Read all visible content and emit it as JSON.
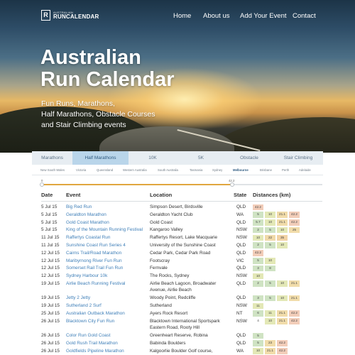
{
  "brand": {
    "small": "AUSTRALIAN",
    "big": "RUNCALENDAR",
    "mark": "R"
  },
  "nav": [
    {
      "label": "Home"
    },
    {
      "label": "About us"
    },
    {
      "label": "Add Your Event"
    },
    {
      "label": "Contact"
    }
  ],
  "hero": {
    "title_line1": "Australian",
    "title_line2": "Run Calendar",
    "sub_line1": "Fun Runs, Marathons,",
    "sub_line2": "Half Marathons, Obstacle Courses",
    "sub_line3": "and Stair Climbing events"
  },
  "categories": [
    {
      "label": "Marathons",
      "active": false
    },
    {
      "label": "Half Marathons",
      "active": true
    },
    {
      "label": "10K",
      "active": false
    },
    {
      "label": "5K",
      "active": false
    },
    {
      "label": "Obstacle",
      "active": false
    },
    {
      "label": "Stair Climbing",
      "active": false
    }
  ],
  "regions": [
    {
      "label": "New South Wales",
      "active": false
    },
    {
      "label": "Victoria",
      "active": false
    },
    {
      "label": "Queensland",
      "active": false
    },
    {
      "label": "Western Australia",
      "active": false
    },
    {
      "label": "South Australia",
      "active": false
    },
    {
      "label": "Tasmania",
      "active": false
    },
    {
      "label": "Sydney",
      "active": false
    },
    {
      "label": "Melbourne",
      "active": true
    },
    {
      "label": "Brisbane",
      "active": false
    },
    {
      "label": "Perth",
      "active": false
    },
    {
      "label": "Adelaide",
      "active": false
    }
  ],
  "slider": {
    "min_label": "0",
    "max_label": "42.2",
    "value_fraction": 0.68
  },
  "table": {
    "headers": {
      "date": "Date",
      "event": "Event",
      "location": "Location",
      "state": "State",
      "distances": "Distances (km)"
    },
    "rows": [
      {
        "date": "5 Jul 15",
        "event": "Big Red Run",
        "location": "Simpson Desert, Birdsville",
        "state": "QLD",
        "distances": [
          "42.2"
        ]
      },
      {
        "date": "5 Jul 15",
        "event": "Geraldton Marathon",
        "location": "Geraldton Yacht Club",
        "state": "WA",
        "distances": [
          "5",
          "10",
          "21.1",
          "42.2"
        ]
      },
      {
        "date": "5 Jul 15",
        "event": "Gold Coast Marathon",
        "location": "Gold Coast",
        "state": "QLD",
        "distances": [
          "5.7",
          "10",
          "21.1",
          "42.2"
        ]
      },
      {
        "date": "5 Jul 15",
        "event": "King of the Mountain Running Festival",
        "location": "Kangaroo Valley",
        "state": "NSW",
        "distances": [
          "2",
          "5",
          "10",
          "25"
        ]
      },
      {
        "date": "11 Jul 15",
        "event": "Raffertys Coastal Run",
        "location": "Raffertys Resort, Lake Macquarie",
        "state": "NSW",
        "distances": [
          "10",
          "22",
          "35"
        ]
      },
      {
        "date": "11 Jul 15",
        "event": "Sunshine Coast Run Series 4",
        "location": "University of the Sunshine Coast",
        "state": "QLD",
        "distances": [
          "2",
          "5",
          "10"
        ]
      },
      {
        "date": "12 Jul 15",
        "event": "Cairns Trail/Road Marathon",
        "location": "Cedar Park, Cedar Park Road",
        "state": "QLD",
        "distances": [
          "42.2"
        ]
      },
      {
        "date": "12 Jul 15",
        "event": "Maribyrnong River Fun Run",
        "location": "Footscray",
        "state": "VIC",
        "distances": [
          "5",
          "10"
        ]
      },
      {
        "date": "12 Jul 15",
        "event": "Somerset Rail Trail Fun Run",
        "location": "Fernvale",
        "state": "QLD",
        "distances": [
          "3",
          "8"
        ]
      },
      {
        "date": "12 Jul 15",
        "event": "Sydney Harbour 10k",
        "location": "The Rocks, Sydney",
        "state": "NSW",
        "distances": [
          "10"
        ]
      },
      {
        "date": "19 Jul 15",
        "event": "Airlie Beach Running Festival",
        "location": "Airlie Beach Lagoon, Broadwater Avenue, Airlie Beach",
        "state": "QLD",
        "distances": [
          "2",
          "5",
          "10",
          "21.1"
        ],
        "tall": true
      },
      {
        "date": "19 Jul 15",
        "event": "Jetty 2 Jetty",
        "location": "Woody Point, Redcliffe",
        "state": "QLD",
        "distances": [
          "3",
          "5",
          "10",
          "21.1"
        ]
      },
      {
        "date": "19 Jul 15",
        "event": "Sutherland 2 Surf",
        "location": "Sutherland",
        "state": "NSW",
        "distances": [
          "11"
        ]
      },
      {
        "date": "25 Jul 15",
        "event": "Australian Outback Marathon",
        "location": "Ayers Rock Resort",
        "state": "NT",
        "distances": [
          "6",
          "11",
          "21.1",
          "42.2"
        ]
      },
      {
        "date": "26 Jul 15",
        "event": "Blacktown City Fun Run",
        "location": "Blacktown International Sportspark Eastern Road, Rooty Hill",
        "state": "NSW",
        "distances": [
          "4",
          "10",
          "21.1",
          "42.2"
        ],
        "tall": true
      },
      {
        "date": "26 Jul 15",
        "event": "Color Run Gold Coast",
        "location": "Greenheart Reserve, Robina",
        "state": "QLD",
        "distances": [
          "5"
        ]
      },
      {
        "date": "26 Jul 15",
        "event": "Gold Rush Trail Marathon",
        "location": "Babinda Boulders",
        "state": "QLD",
        "distances": [
          "5",
          "23",
          "42.2"
        ]
      },
      {
        "date": "26 Jul 15",
        "event": "Goldfields Pipeline Marathon",
        "location": "Kalgoorlie Boulder Golf course, Kalgoorlie",
        "state": "WA",
        "distances": [
          "10",
          "21.1",
          "42.2"
        ]
      }
    ]
  },
  "colors": {
    "tab_bar": "#e7edf2",
    "tab_active": "#b9d5ea",
    "link": "#3f7fb8",
    "slider_fill": "#e0a63f",
    "dist_short": "#cfe3c3",
    "dist_10": "#e3e8b6",
    "dist_half": "#f1dcaa",
    "dist_full": "#f2cdb9"
  }
}
